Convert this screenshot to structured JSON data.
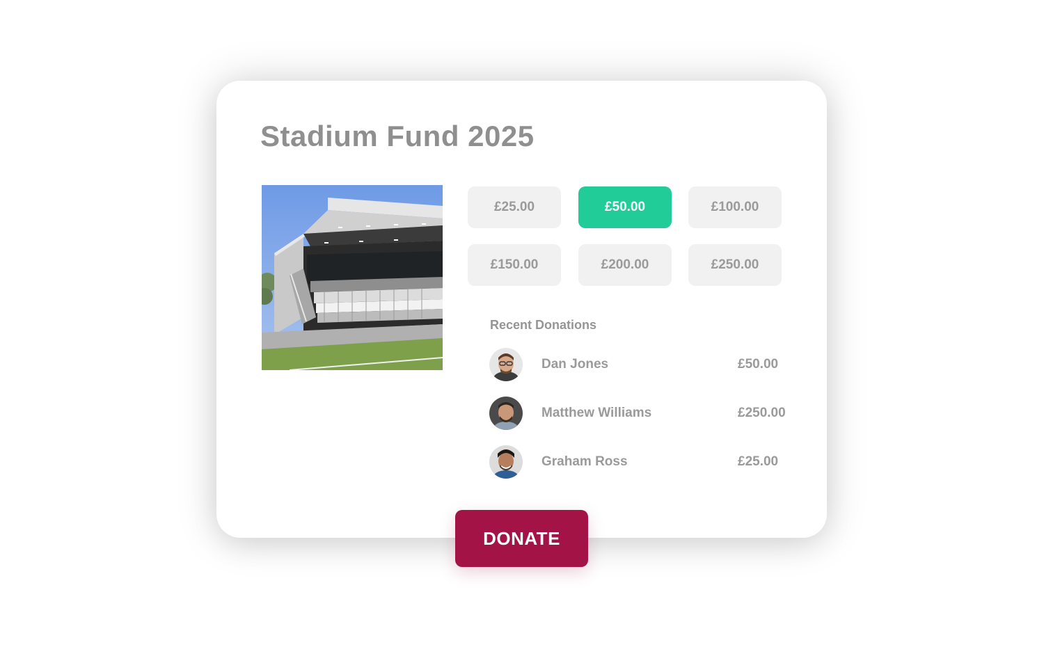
{
  "campaign": {
    "title": "Stadium Fund 2025"
  },
  "amounts": [
    {
      "label": "£25.00",
      "selected": false
    },
    {
      "label": "£50.00",
      "selected": true
    },
    {
      "label": "£100.00",
      "selected": false
    },
    {
      "label": "£150.00",
      "selected": false
    },
    {
      "label": "£200.00",
      "selected": false
    },
    {
      "label": "£250.00",
      "selected": false
    }
  ],
  "recent": {
    "heading": "Recent Donations",
    "donors": [
      {
        "name": "Dan Jones",
        "amount": "£50.00"
      },
      {
        "name": "Matthew Williams",
        "amount": "£250.00"
      },
      {
        "name": "Graham Ross",
        "amount": "£25.00"
      }
    ]
  },
  "actions": {
    "donate_label": "DONATE"
  },
  "colors": {
    "selected_amount": "#22cc99",
    "donate_button": "#a31346",
    "text_grey": "#9a9a9a"
  }
}
